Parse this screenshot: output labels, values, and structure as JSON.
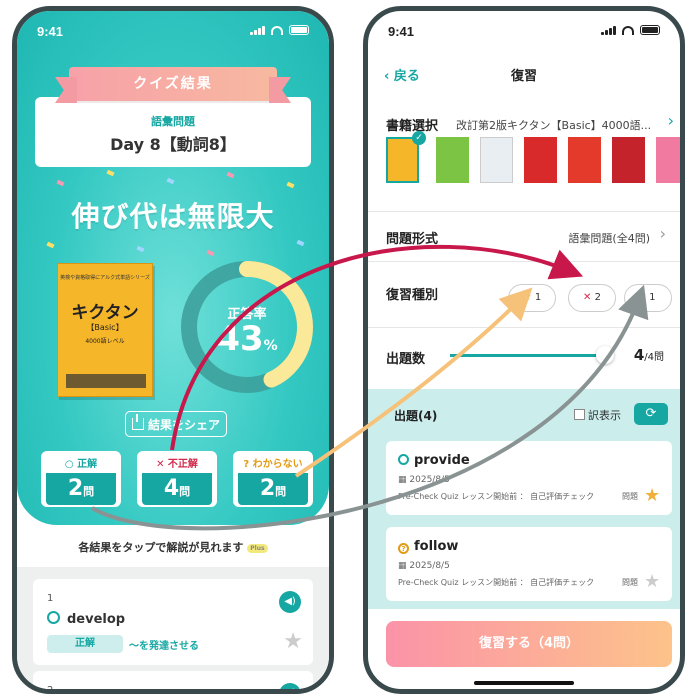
{
  "left": {
    "status_time": "9:41",
    "ribbon_title": "クイズ結果",
    "quiz_type": "語彙問題",
    "quiz_title": "Day 8【動詞8】",
    "headline": "伸び代は無限大",
    "book": {
      "series": "英検や資格取得にアルク式単語シリーズ",
      "title": "キクタン",
      "level": "【Basic】",
      "subtitle": "4000語レベル"
    },
    "gauge": {
      "label": "正答率",
      "value": "43",
      "unit": "%",
      "percent": 43
    },
    "share_label": "結果をシェア",
    "stats": [
      {
        "label": "○ 正解",
        "value": "2",
        "unit": "問"
      },
      {
        "label": "✕ 不正解",
        "value": "4",
        "unit": "問"
      },
      {
        "label": "? わからない",
        "value": "2",
        "unit": "問"
      }
    ],
    "hint": "各結果をタップで解説が見れます",
    "hint_badge": "Plus",
    "items": [
      {
        "num": "1",
        "word": "develop",
        "result": "正解",
        "meaning": "〜を発達させる"
      },
      {
        "num": "2"
      }
    ]
  },
  "right": {
    "status_time": "9:41",
    "back_label": "戻る",
    "nav_title": "復習",
    "book_row": {
      "label": "書籍選択",
      "value": "改訂第2版キクタン【Basic】4000語..."
    },
    "format_row": {
      "label": "問題形式",
      "value": "語彙問題(全4問)"
    },
    "type_row": {
      "label": "復習種別",
      "pills": [
        {
          "icon": "★",
          "count": "1"
        },
        {
          "icon": "✕",
          "count": "2"
        },
        {
          "icon": "?",
          "count": "1"
        }
      ]
    },
    "count_row": {
      "label": "出題数",
      "value": "4",
      "unit": "/4問",
      "fraction": 1.0
    },
    "questions_head": "出題(4)",
    "translate_label": "訳表示",
    "questions": [
      {
        "word": "provide",
        "date": "2025/8/5",
        "source": "Pre-Check Quiz レッスン開始前 ： 自己評価チェック",
        "tag": "問題"
      },
      {
        "word": "follow",
        "date": "2025/8/5",
        "source": "Pre-Check Quiz レッスン開始前 ： 自己評価チェック",
        "tag": "問題"
      }
    ],
    "review_button": "復習する（4問）"
  },
  "colors": {
    "teal": "#16a7a3",
    "incorrect": "#d12a4a",
    "unknown": "#e29b12",
    "arrow_red": "#c8174a",
    "arrow_orange": "#f6c27a",
    "arrow_gray": "#8a9393"
  }
}
